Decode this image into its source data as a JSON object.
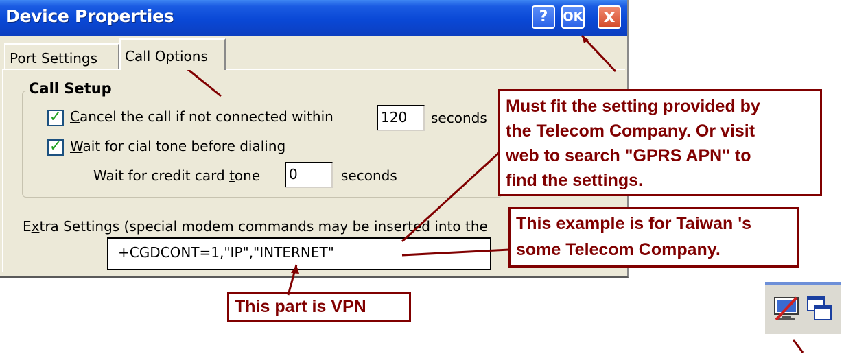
{
  "window": {
    "title": "Device Properties",
    "help_label": "?",
    "ok_label": "OK",
    "close_label": "x"
  },
  "tabs": [
    {
      "label": "Port Settings",
      "active": false
    },
    {
      "label": "Call Options",
      "active": true
    }
  ],
  "call_setup": {
    "title": "Call Setup",
    "cancel_call": {
      "checked": true,
      "label_first": "C",
      "label_rest": "ancel the call if not connected within",
      "value": "120",
      "unit": "seconds"
    },
    "wait_dial_tone": {
      "checked": true,
      "label_first": "W",
      "label_rest": "ait for cial tone before dialing"
    },
    "credit_card": {
      "label_pre": "Wait for credit card ",
      "label_ul": "t",
      "label_post": "one",
      "value": "0",
      "unit": "seconds"
    }
  },
  "extra_settings": {
    "label_pre": "E",
    "label_ul": "x",
    "label_post": "tra Settings (special modem commands may be inserted into the",
    "value": "+CGDCONT=1,\"IP\",\"INTERNET\""
  },
  "callouts": {
    "apn_note": [
      "Must fit the setting provided by",
      "the Telecom Company. Or visit",
      "web to search \"GPRS APN\" to",
      "find the settings."
    ],
    "taiwan_note": [
      "This example is for Taiwan 's",
      "some Telecom Company."
    ],
    "vpn_note": "This part is VPN"
  },
  "colors": {
    "callout": "#800000",
    "titlebar": "#0a48d6",
    "dialog_bg": "#ece9d8",
    "check": "#21a121"
  },
  "taskbar": {
    "icons": [
      "network-connection-icon",
      "window-switch-icon"
    ]
  }
}
